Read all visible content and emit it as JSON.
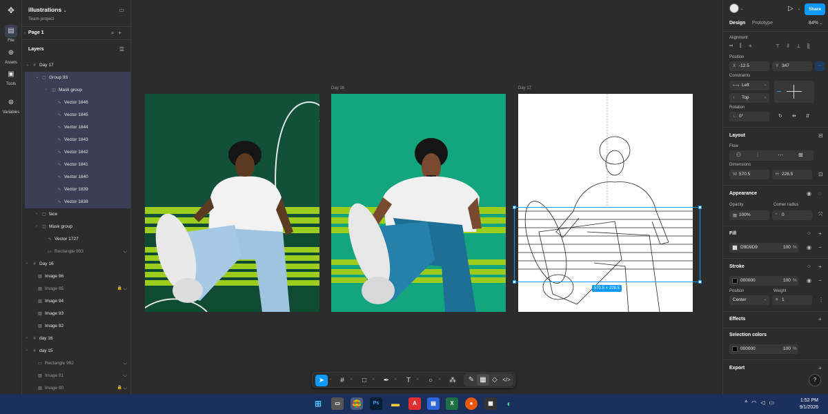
{
  "rail": {
    "items": [
      {
        "label": "File",
        "icon": "file-icon"
      },
      {
        "label": "Assets",
        "icon": "assets-icon"
      },
      {
        "label": "Tools",
        "icon": "tools-icon"
      },
      {
        "label": "Variables",
        "icon": "variables-icon"
      }
    ]
  },
  "file": {
    "title": "illustrations",
    "subtitle": "Team project"
  },
  "page": {
    "label": "Page 1"
  },
  "layers": {
    "header": "Layers",
    "items": [
      {
        "label": "Day 17"
      },
      {
        "label": "Group 93"
      },
      {
        "label": "Mask group"
      },
      {
        "label": "Vector 1846"
      },
      {
        "label": "Vector 1845"
      },
      {
        "label": "Vector 1844"
      },
      {
        "label": "Vector 1843"
      },
      {
        "label": "Vector 1842"
      },
      {
        "label": "Vector 1841"
      },
      {
        "label": "Vector 1840"
      },
      {
        "label": "Vector 1839"
      },
      {
        "label": "Vector 1838"
      },
      {
        "label": "face"
      },
      {
        "label": "Mask group"
      },
      {
        "label": "Vector 1727"
      },
      {
        "label": "Rectangle 993"
      },
      {
        "label": "Day 16"
      },
      {
        "label": "Image 96"
      },
      {
        "label": "Image 95"
      },
      {
        "label": "Image 94"
      },
      {
        "label": "Image 93"
      },
      {
        "label": "Image 92"
      },
      {
        "label": "day 16"
      },
      {
        "label": "day 15"
      },
      {
        "label": "Rectangle 992"
      },
      {
        "label": "Image 91"
      },
      {
        "label": "Image 90"
      }
    ]
  },
  "canvas": {
    "frame_labels": [
      "Day 16",
      "Day 17"
    ],
    "selection_size": "570.5 × 228.5"
  },
  "header": {
    "share_label": "Share"
  },
  "tabs": {
    "design": "Design",
    "prototype": "Prototype",
    "zoom": "84%"
  },
  "design": {
    "alignment_label": "Alignment",
    "position_label": "Position",
    "x_prefix": "X",
    "x_value": "-12.5",
    "y_prefix": "Y",
    "y_value": "347",
    "constraints_label": "Constraints",
    "constraint_h": "Left",
    "constraint_v": "Top",
    "rotation_label": "Rotation",
    "rotation_value": "0°",
    "layout_title": "Layout",
    "flow_label": "Flow",
    "dimensions_label": "Dimensions",
    "w_prefix": "W",
    "w_value": "570.5",
    "h_prefix": "H",
    "h_value": "228.5",
    "appearance_title": "Appearance",
    "opacity_label": "Opacity",
    "opacity_value": "100%",
    "radius_label": "Corner radius",
    "radius_value": "0",
    "fill_title": "Fill",
    "fill_hex": "D9D9D9",
    "fill_opacity": "100",
    "fill_color": "#D9D9D9",
    "stroke_title": "Stroke",
    "stroke_hex": "000000",
    "stroke_opacity": "100",
    "stroke_color": "#000000",
    "stroke_position_label": "Position",
    "stroke_weight_label": "Weight",
    "stroke_position": "Center",
    "stroke_weight": "1",
    "effects_title": "Effects",
    "selection_colors_title": "Selection colors",
    "sel_hex": "000000",
    "sel_opacity": "100",
    "export_title": "Export",
    "percent": "%"
  },
  "taskbar": {
    "time": "1:52 PM",
    "date": "9/1/2026"
  },
  "colors": {
    "accent": "#0d99ff",
    "selected_layer": "#3b3f55",
    "frame16_bg": "#13a57d",
    "frame15_bg": "#0f4a33",
    "bench": "#9ccc1c"
  }
}
